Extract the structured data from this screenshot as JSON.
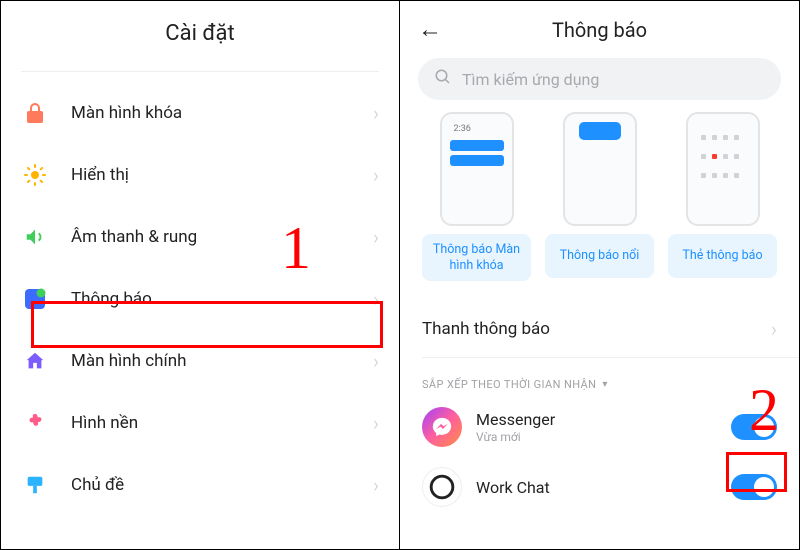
{
  "left": {
    "title": "Cài đặt",
    "items": [
      {
        "label": "Màn hình khóa"
      },
      {
        "label": "Hiển thị"
      },
      {
        "label": "Âm thanh & rung"
      },
      {
        "label": "Thông báo"
      },
      {
        "label": "Màn hình chính"
      },
      {
        "label": "Hình nền"
      },
      {
        "label": "Chủ đề"
      }
    ]
  },
  "right": {
    "title": "Thông báo",
    "search_placeholder": "Tìm kiếm ứng dụng",
    "triptych": {
      "lock_time": "2:36",
      "labels": [
        "Thông báo Màn hình khóa",
        "Thông báo nổi",
        "Thẻ thông báo"
      ]
    },
    "section_notification_bar": "Thanh thông báo",
    "sort_header": "SẮP XẾP THEO THỜI GIAN NHẬN",
    "apps": [
      {
        "name": "Messenger",
        "sub": "Vừa mới",
        "toggle": true
      },
      {
        "name": "Work Chat",
        "sub": "",
        "toggle": true
      }
    ]
  },
  "annotations": {
    "one": "1",
    "two": "2"
  },
  "colors": {
    "accent": "#1e90ff",
    "highlight": "#ff0000"
  }
}
